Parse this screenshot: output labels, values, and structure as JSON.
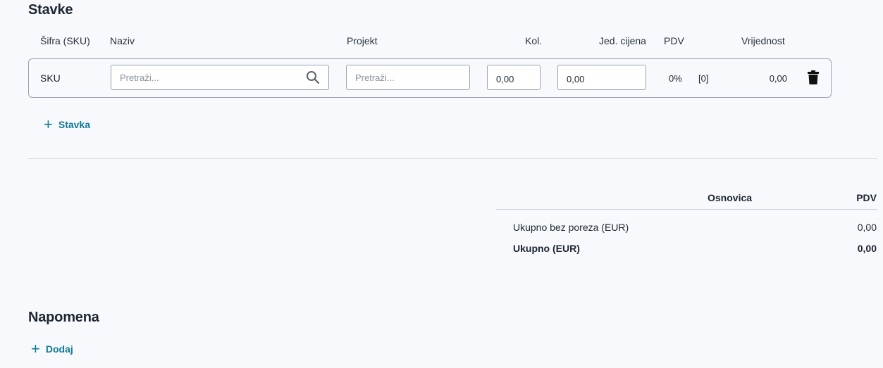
{
  "items_section": {
    "title": "Stavke",
    "columns": {
      "sku": "Šifra (SKU)",
      "name": "Naziv",
      "project": "Projekt",
      "qty": "Kol.",
      "unit_price": "Jed. cijena",
      "vat": "PDV",
      "value": "Vrijednost"
    },
    "row": {
      "sku": "SKU",
      "name_placeholder": "Pretraži...",
      "project_placeholder": "Pretraži...",
      "qty": "0,00",
      "unit_price": "0,00",
      "vat_percent": "0%",
      "vat_code": "[0]",
      "value": "0,00"
    },
    "add_label": "Stavka"
  },
  "summary": {
    "col_base": "Osnovica",
    "col_vat": "PDV",
    "subtotal_label": "Ukupno bez poreza (EUR)",
    "subtotal_value": "0,00",
    "total_label": "Ukupno (EUR)",
    "total_value": "0,00"
  },
  "note_section": {
    "title": "Napomena",
    "add_label": "Dodaj"
  },
  "icons": {
    "search": "search-icon",
    "delete": "trash-icon",
    "add": "plus-icon"
  },
  "colors": {
    "accent": "#127a98",
    "background": "#f7f9fc",
    "border": "#9aa3ad"
  }
}
